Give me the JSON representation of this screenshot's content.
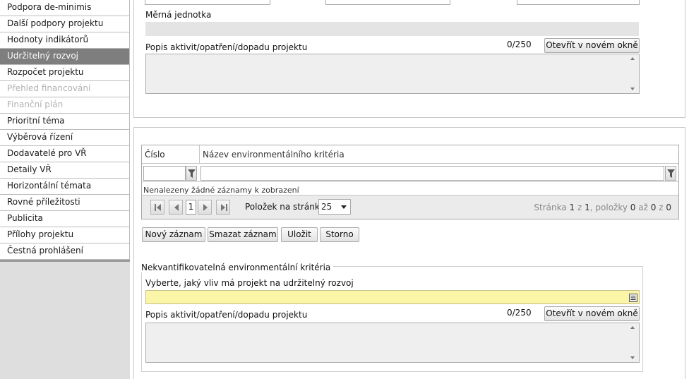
{
  "sidebar": {
    "items": [
      {
        "label": "Podpora de-minimis",
        "state": "normal"
      },
      {
        "label": "Další podpory projektu",
        "state": "normal"
      },
      {
        "label": "Hodnoty indikátorů",
        "state": "normal"
      },
      {
        "label": "Udržitelný rozvoj",
        "state": "active"
      },
      {
        "label": "Rozpočet projektu",
        "state": "normal"
      },
      {
        "label": "Přehled financování",
        "state": "disabled"
      },
      {
        "label": "Finanční plán",
        "state": "disabled"
      },
      {
        "label": "Prioritní téma",
        "state": "normal"
      },
      {
        "label": "Výběrová řízení",
        "state": "normal"
      },
      {
        "label": "Dodavatelé pro VŘ",
        "state": "normal"
      },
      {
        "label": "Detaily VŘ",
        "state": "normal"
      },
      {
        "label": "Horizontální témata",
        "state": "normal"
      },
      {
        "label": "Rovné příležitosti",
        "state": "normal"
      },
      {
        "label": "Publicita",
        "state": "normal"
      },
      {
        "label": "Přílohy projektu",
        "state": "normal"
      },
      {
        "label": "Čestná prohlášení",
        "state": "normal"
      }
    ]
  },
  "top_panel": {
    "unit_label": "Měrná jednotka",
    "unit_value": "",
    "description_label": "Popis aktivit/opatření/dopadu projektu",
    "counter": "0/250",
    "open_window_label": "Otevřít v novém okně",
    "description_value": ""
  },
  "grid": {
    "columns": [
      "Číslo",
      "Název environmentálního kritéria"
    ],
    "empty_message": "Nenalezeny žádné záznamy k zobrazení",
    "current_page": "1",
    "page_size_label": "Položek na stránku",
    "page_size": "25",
    "page_info_prefix": "Stránka",
    "page_current": "1",
    "page_of": "z",
    "page_total": "1",
    "items_label": ", položky",
    "items_from": "0",
    "items_to_word": "až",
    "items_to": "0",
    "items_of_word": "z",
    "items_total": "0"
  },
  "actions": {
    "new": "Nový záznam",
    "delete": "Smazat záznam",
    "save": "Uložit",
    "cancel": "Storno"
  },
  "nonquant": {
    "legend": "Nekvantifikovatelná environmentální kritéria",
    "impact_label": "Vyberte, jaký vliv má projekt na udržitelný rozvoj",
    "impact_value": "",
    "description_label": "Popis aktivit/opatření/dopadu projektu",
    "counter": "0/250",
    "open_window_label": "Otevřít v novém okně",
    "description_value": ""
  },
  "colors": {
    "active_item": "#7e7e7e",
    "required_field": "#fbf5a8",
    "readonly_field": "#e4e4e4"
  }
}
